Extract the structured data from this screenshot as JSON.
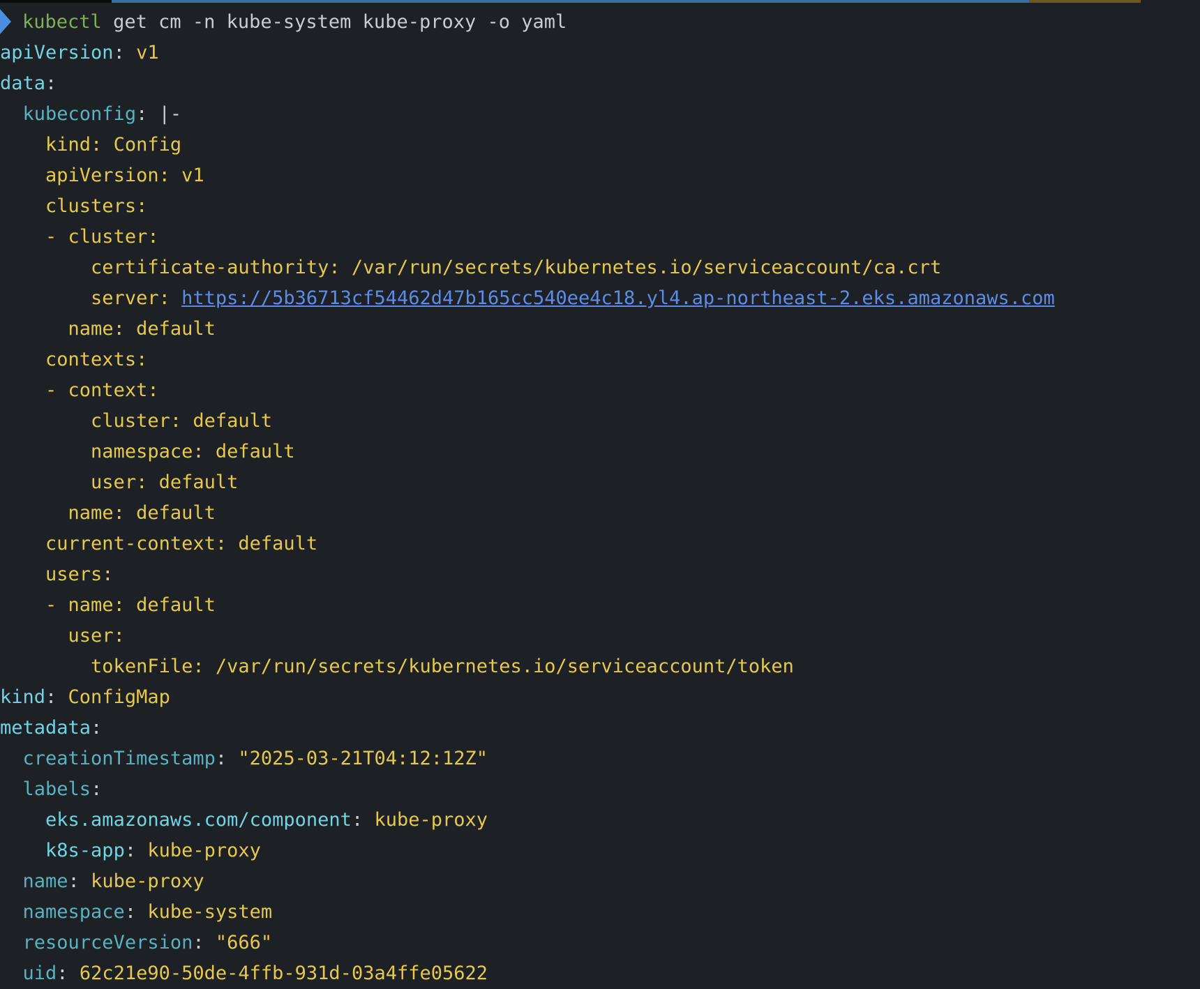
{
  "command": {
    "name": "kubectl",
    "args": "get cm -n kube-system kube-proxy -o yaml"
  },
  "yaml": {
    "apiVersion_key": "apiVersion",
    "apiVersion_val": "v1",
    "data_key": "data",
    "kubeconfig_key": "kubeconfig",
    "kubeconfig_indicator": "|-",
    "block": {
      "kind": "kind: Config",
      "apiVersion": "apiVersion: v1",
      "clusters": "clusters:",
      "cluster_item": "- cluster:",
      "cert_authority": "certificate-authority: /var/run/secrets/kubernetes.io/serviceaccount/ca.crt",
      "server_label": "server: ",
      "server_url": "https://5b36713cf54462d47b165cc540ee4c18.yl4.ap-northeast-2.eks.amazonaws.com",
      "cluster_name": "name: default",
      "contexts": "contexts:",
      "context_item": "- context:",
      "context_cluster": "cluster: default",
      "context_namespace": "namespace: default",
      "context_user": "user: default",
      "context_name": "name: default",
      "current_context": "current-context: default",
      "users": "users:",
      "user_item": "- name: default",
      "user_key": "user:",
      "token_file": "tokenFile: /var/run/secrets/kubernetes.io/serviceaccount/token"
    },
    "kind_key": "kind",
    "kind_val": "ConfigMap",
    "metadata_key": "metadata",
    "creation_key": "creationTimestamp",
    "creation_val": "\"2025-03-21T04:12:12Z\"",
    "labels_key": "labels",
    "label_component_key": "eks.amazonaws.com/component",
    "label_component_val": "kube-proxy",
    "label_app_key": "k8s-app",
    "label_app_val": "kube-proxy",
    "name_key": "name",
    "name_val": "kube-proxy",
    "namespace_key": "namespace",
    "namespace_val": "kube-system",
    "rv_key": "resourceVersion",
    "rv_val": "\"666\"",
    "uid_key": "uid",
    "uid_val": "62c21e90-50de-4ffb-931d-03a4ffe05622"
  },
  "colors": {
    "background": "#1d2025",
    "prompt": "#4b8fdf",
    "command": "#7fb24e",
    "top_key": "#6fd4e3",
    "nested_key": "#56b3bf",
    "value": "#e6c84c",
    "link": "#5b8de8"
  },
  "icons": {
    "prompt": "prompt-arrow-icon"
  }
}
